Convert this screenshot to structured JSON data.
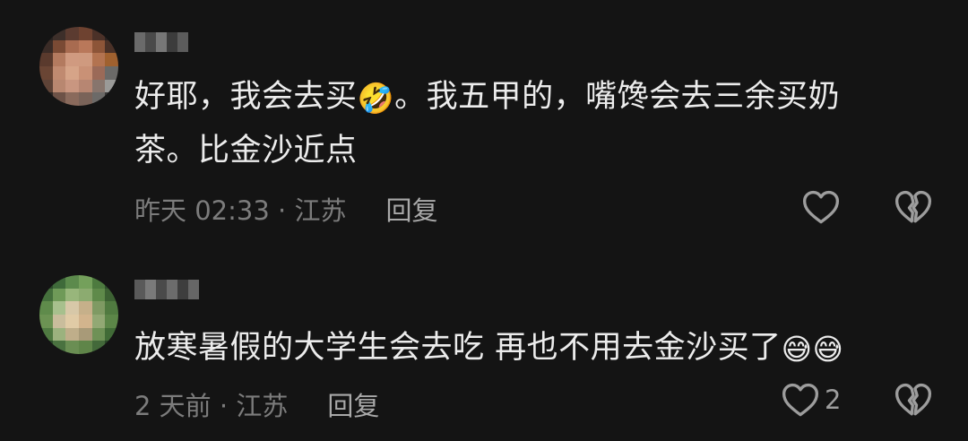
{
  "comments": [
    {
      "text_line1": "好耶，我会去买",
      "emoji": "🤣",
      "text_line1_tail": "。我五甲的，嘴馋会去三余买奶",
      "text_line2": "茶。比金沙近点",
      "time_location": "昨天 02:33 · 江苏",
      "reply_label": "回复",
      "like_count": ""
    },
    {
      "text": "放寒暑假的大学生会去吃 再也不用去金沙买了",
      "emoji": "😅😅",
      "time_location": "2 天前 · 江苏",
      "reply_label": "回复",
      "like_count": "2"
    }
  ],
  "icons": {
    "like": "heart-outline-icon",
    "dislike": "broken-heart-icon"
  },
  "colors": {
    "background": "#141414",
    "text": "#ececec",
    "meta": "#7c7c7c",
    "icon": "#9d9d9d"
  }
}
